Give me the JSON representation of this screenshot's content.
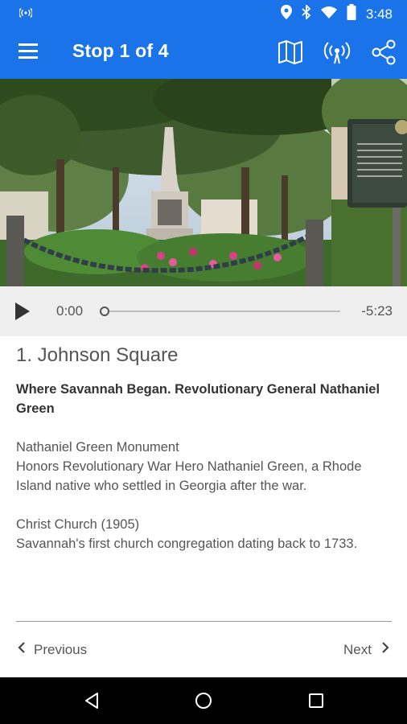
{
  "status_bar": {
    "time": "3:48"
  },
  "app_bar": {
    "title": "Stop 1 of 4"
  },
  "player": {
    "elapsed": "0:00",
    "remaining": "-5:23",
    "progress": 0.0
  },
  "stop": {
    "title": "1. Johnson Square",
    "subtitle": "Where Savannah Began. Revolutionary General Nathaniel Green",
    "sections": [
      {
        "heading": "Nathaniel Green Monument",
        "body": "Honors Revolutionary War Hero Nathaniel Green, a Rhode Island native who settled in Georgia after the war."
      },
      {
        "heading": "Christ Church (1905)",
        "body": "Savannah's first church congregation dating back to 1733."
      }
    ]
  },
  "navigation": {
    "previous_label": "Previous",
    "next_label": "Next"
  },
  "colors": {
    "app_bar": "#1a73e8",
    "player_bg": "#efefef",
    "text": "#555555"
  },
  "icons": [
    "wifi-signal-icon",
    "location-icon",
    "bluetooth-icon",
    "wifi-icon",
    "battery-icon",
    "menu-icon",
    "map-icon",
    "broadcast-icon",
    "share-icon",
    "play-icon",
    "chevron-left-icon",
    "chevron-right-icon",
    "back-triangle-icon",
    "home-circle-icon",
    "recents-square-icon"
  ]
}
